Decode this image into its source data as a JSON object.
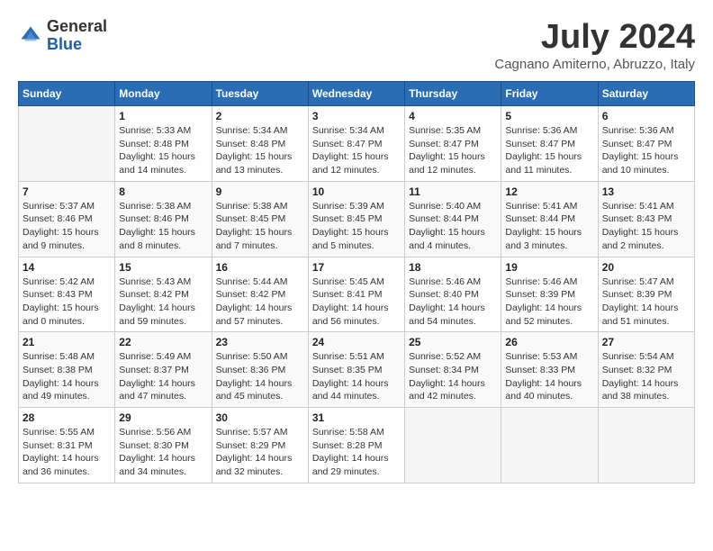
{
  "logo": {
    "general": "General",
    "blue": "Blue"
  },
  "title": "July 2024",
  "location": "Cagnano Amiterno, Abruzzo, Italy",
  "days_header": [
    "Sunday",
    "Monday",
    "Tuesday",
    "Wednesday",
    "Thursday",
    "Friday",
    "Saturday"
  ],
  "weeks": [
    [
      {
        "day": "",
        "sunrise": "",
        "sunset": "",
        "daylight": ""
      },
      {
        "day": "1",
        "sunrise": "Sunrise: 5:33 AM",
        "sunset": "Sunset: 8:48 PM",
        "daylight": "Daylight: 15 hours and 14 minutes."
      },
      {
        "day": "2",
        "sunrise": "Sunrise: 5:34 AM",
        "sunset": "Sunset: 8:48 PM",
        "daylight": "Daylight: 15 hours and 13 minutes."
      },
      {
        "day": "3",
        "sunrise": "Sunrise: 5:34 AM",
        "sunset": "Sunset: 8:47 PM",
        "daylight": "Daylight: 15 hours and 12 minutes."
      },
      {
        "day": "4",
        "sunrise": "Sunrise: 5:35 AM",
        "sunset": "Sunset: 8:47 PM",
        "daylight": "Daylight: 15 hours and 12 minutes."
      },
      {
        "day": "5",
        "sunrise": "Sunrise: 5:36 AM",
        "sunset": "Sunset: 8:47 PM",
        "daylight": "Daylight: 15 hours and 11 minutes."
      },
      {
        "day": "6",
        "sunrise": "Sunrise: 5:36 AM",
        "sunset": "Sunset: 8:47 PM",
        "daylight": "Daylight: 15 hours and 10 minutes."
      }
    ],
    [
      {
        "day": "7",
        "sunrise": "Sunrise: 5:37 AM",
        "sunset": "Sunset: 8:46 PM",
        "daylight": "Daylight: 15 hours and 9 minutes."
      },
      {
        "day": "8",
        "sunrise": "Sunrise: 5:38 AM",
        "sunset": "Sunset: 8:46 PM",
        "daylight": "Daylight: 15 hours and 8 minutes."
      },
      {
        "day": "9",
        "sunrise": "Sunrise: 5:38 AM",
        "sunset": "Sunset: 8:45 PM",
        "daylight": "Daylight: 15 hours and 7 minutes."
      },
      {
        "day": "10",
        "sunrise": "Sunrise: 5:39 AM",
        "sunset": "Sunset: 8:45 PM",
        "daylight": "Daylight: 15 hours and 5 minutes."
      },
      {
        "day": "11",
        "sunrise": "Sunrise: 5:40 AM",
        "sunset": "Sunset: 8:44 PM",
        "daylight": "Daylight: 15 hours and 4 minutes."
      },
      {
        "day": "12",
        "sunrise": "Sunrise: 5:41 AM",
        "sunset": "Sunset: 8:44 PM",
        "daylight": "Daylight: 15 hours and 3 minutes."
      },
      {
        "day": "13",
        "sunrise": "Sunrise: 5:41 AM",
        "sunset": "Sunset: 8:43 PM",
        "daylight": "Daylight: 15 hours and 2 minutes."
      }
    ],
    [
      {
        "day": "14",
        "sunrise": "Sunrise: 5:42 AM",
        "sunset": "Sunset: 8:43 PM",
        "daylight": "Daylight: 15 hours and 0 minutes."
      },
      {
        "day": "15",
        "sunrise": "Sunrise: 5:43 AM",
        "sunset": "Sunset: 8:42 PM",
        "daylight": "Daylight: 14 hours and 59 minutes."
      },
      {
        "day": "16",
        "sunrise": "Sunrise: 5:44 AM",
        "sunset": "Sunset: 8:42 PM",
        "daylight": "Daylight: 14 hours and 57 minutes."
      },
      {
        "day": "17",
        "sunrise": "Sunrise: 5:45 AM",
        "sunset": "Sunset: 8:41 PM",
        "daylight": "Daylight: 14 hours and 56 minutes."
      },
      {
        "day": "18",
        "sunrise": "Sunrise: 5:46 AM",
        "sunset": "Sunset: 8:40 PM",
        "daylight": "Daylight: 14 hours and 54 minutes."
      },
      {
        "day": "19",
        "sunrise": "Sunrise: 5:46 AM",
        "sunset": "Sunset: 8:39 PM",
        "daylight": "Daylight: 14 hours and 52 minutes."
      },
      {
        "day": "20",
        "sunrise": "Sunrise: 5:47 AM",
        "sunset": "Sunset: 8:39 PM",
        "daylight": "Daylight: 14 hours and 51 minutes."
      }
    ],
    [
      {
        "day": "21",
        "sunrise": "Sunrise: 5:48 AM",
        "sunset": "Sunset: 8:38 PM",
        "daylight": "Daylight: 14 hours and 49 minutes."
      },
      {
        "day": "22",
        "sunrise": "Sunrise: 5:49 AM",
        "sunset": "Sunset: 8:37 PM",
        "daylight": "Daylight: 14 hours and 47 minutes."
      },
      {
        "day": "23",
        "sunrise": "Sunrise: 5:50 AM",
        "sunset": "Sunset: 8:36 PM",
        "daylight": "Daylight: 14 hours and 45 minutes."
      },
      {
        "day": "24",
        "sunrise": "Sunrise: 5:51 AM",
        "sunset": "Sunset: 8:35 PM",
        "daylight": "Daylight: 14 hours and 44 minutes."
      },
      {
        "day": "25",
        "sunrise": "Sunrise: 5:52 AM",
        "sunset": "Sunset: 8:34 PM",
        "daylight": "Daylight: 14 hours and 42 minutes."
      },
      {
        "day": "26",
        "sunrise": "Sunrise: 5:53 AM",
        "sunset": "Sunset: 8:33 PM",
        "daylight": "Daylight: 14 hours and 40 minutes."
      },
      {
        "day": "27",
        "sunrise": "Sunrise: 5:54 AM",
        "sunset": "Sunset: 8:32 PM",
        "daylight": "Daylight: 14 hours and 38 minutes."
      }
    ],
    [
      {
        "day": "28",
        "sunrise": "Sunrise: 5:55 AM",
        "sunset": "Sunset: 8:31 PM",
        "daylight": "Daylight: 14 hours and 36 minutes."
      },
      {
        "day": "29",
        "sunrise": "Sunrise: 5:56 AM",
        "sunset": "Sunset: 8:30 PM",
        "daylight": "Daylight: 14 hours and 34 minutes."
      },
      {
        "day": "30",
        "sunrise": "Sunrise: 5:57 AM",
        "sunset": "Sunset: 8:29 PM",
        "daylight": "Daylight: 14 hours and 32 minutes."
      },
      {
        "day": "31",
        "sunrise": "Sunrise: 5:58 AM",
        "sunset": "Sunset: 8:28 PM",
        "daylight": "Daylight: 14 hours and 29 minutes."
      },
      {
        "day": "",
        "sunrise": "",
        "sunset": "",
        "daylight": ""
      },
      {
        "day": "",
        "sunrise": "",
        "sunset": "",
        "daylight": ""
      },
      {
        "day": "",
        "sunrise": "",
        "sunset": "",
        "daylight": ""
      }
    ]
  ]
}
